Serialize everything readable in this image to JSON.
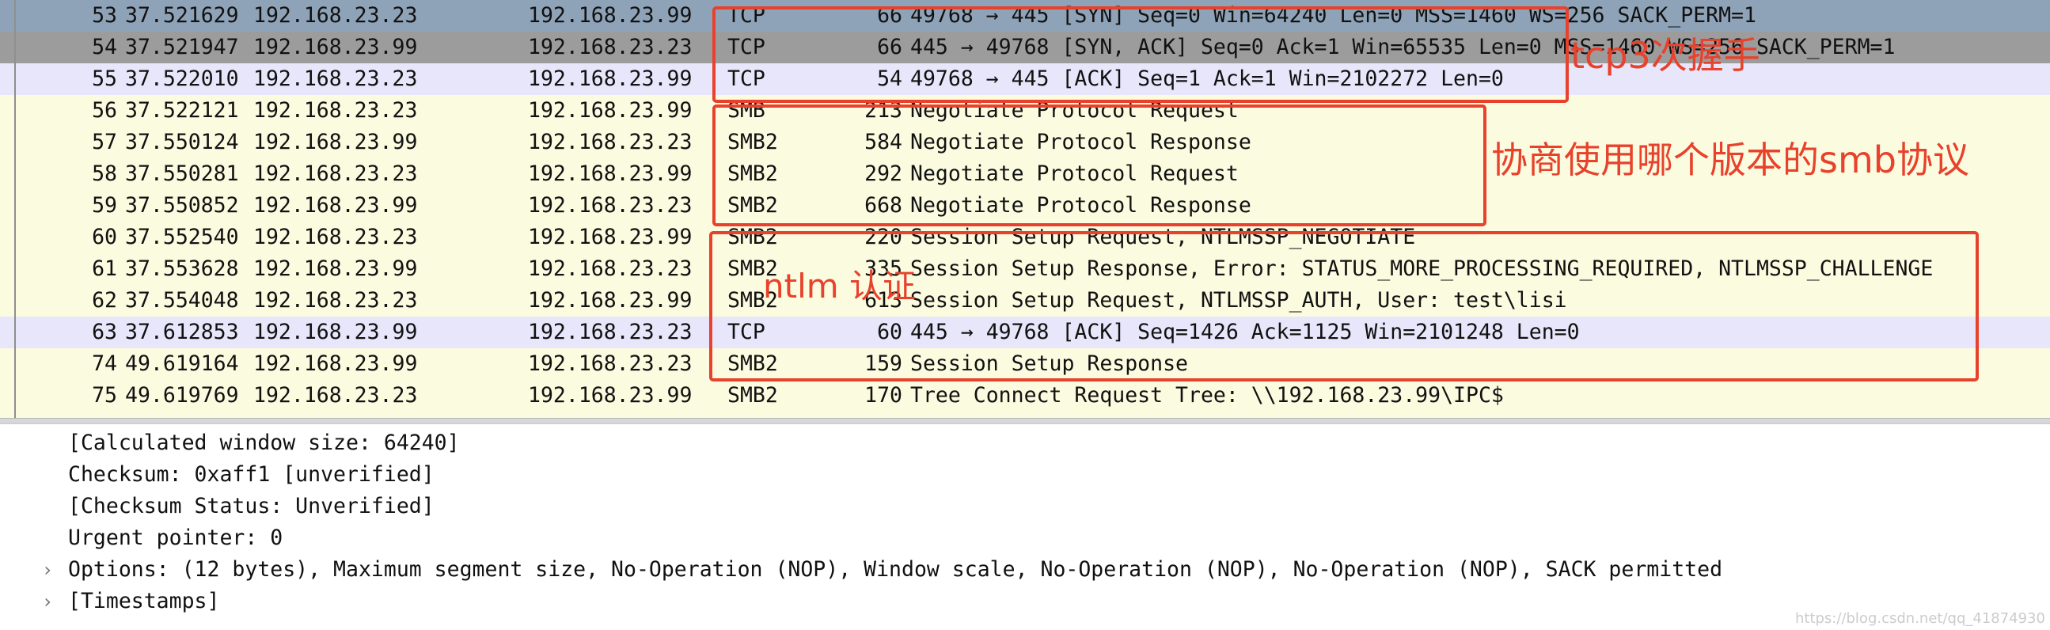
{
  "packets": [
    {
      "no": "53",
      "time": "37.521629",
      "src": "192.168.23.23",
      "dst": "192.168.23.99",
      "proto": "TCP",
      "len": "66",
      "info": "49768 → 445 [SYN] Seq=0 Win=64240 Len=0 MSS=1460 WS=256 SACK_PERM=1",
      "style": "selected"
    },
    {
      "no": "54",
      "time": "37.521947",
      "src": "192.168.23.99",
      "dst": "192.168.23.23",
      "proto": "TCP",
      "len": "66",
      "info": "445 → 49768 [SYN, ACK] Seq=0 Ack=1 Win=65535 Len=0 MSS=1460 WS=256 SACK_PERM=1",
      "style": "gray"
    },
    {
      "no": "55",
      "time": "37.522010",
      "src": "192.168.23.23",
      "dst": "192.168.23.99",
      "proto": "TCP",
      "len": "54",
      "info": "49768 → 445 [ACK] Seq=1 Ack=1 Win=2102272 Len=0",
      "style": "tcp"
    },
    {
      "no": "56",
      "time": "37.522121",
      "src": "192.168.23.23",
      "dst": "192.168.23.99",
      "proto": "SMB",
      "len": "213",
      "info": "Negotiate Protocol Request",
      "style": "smb"
    },
    {
      "no": "57",
      "time": "37.550124",
      "src": "192.168.23.99",
      "dst": "192.168.23.23",
      "proto": "SMB2",
      "len": "584",
      "info": "Negotiate Protocol Response",
      "style": "smb"
    },
    {
      "no": "58",
      "time": "37.550281",
      "src": "192.168.23.23",
      "dst": "192.168.23.99",
      "proto": "SMB2",
      "len": "292",
      "info": "Negotiate Protocol Request",
      "style": "smb"
    },
    {
      "no": "59",
      "time": "37.550852",
      "src": "192.168.23.99",
      "dst": "192.168.23.23",
      "proto": "SMB2",
      "len": "668",
      "info": "Negotiate Protocol Response",
      "style": "smb"
    },
    {
      "no": "60",
      "time": "37.552540",
      "src": "192.168.23.23",
      "dst": "192.168.23.99",
      "proto": "SMB2",
      "len": "220",
      "info": "Session Setup Request, NTLMSSP_NEGOTIATE",
      "style": "smb"
    },
    {
      "no": "61",
      "time": "37.553628",
      "src": "192.168.23.99",
      "dst": "192.168.23.23",
      "proto": "SMB2",
      "len": "335",
      "info": "Session Setup Response, Error: STATUS_MORE_PROCESSING_REQUIRED, NTLMSSP_CHALLENGE",
      "style": "smb"
    },
    {
      "no": "62",
      "time": "37.554048",
      "src": "192.168.23.23",
      "dst": "192.168.23.99",
      "proto": "SMB2",
      "len": "613",
      "info": "Session Setup Request, NTLMSSP_AUTH, User: test\\lisi",
      "style": "smb"
    },
    {
      "no": "63",
      "time": "37.612853",
      "src": "192.168.23.99",
      "dst": "192.168.23.23",
      "proto": "TCP",
      "len": "60",
      "info": "445 → 49768 [ACK] Seq=1426 Ack=1125 Win=2101248 Len=0",
      "style": "tcp"
    },
    {
      "no": "74",
      "time": "49.619164",
      "src": "192.168.23.99",
      "dst": "192.168.23.23",
      "proto": "SMB2",
      "len": "159",
      "info": "Session Setup Response",
      "style": "smb"
    },
    {
      "no": "75",
      "time": "49.619769",
      "src": "192.168.23.23",
      "dst": "192.168.23.99",
      "proto": "SMB2",
      "len": "170",
      "info": "Tree Connect Request Tree: \\\\192.168.23.99\\IPC$",
      "style": "smb"
    }
  ],
  "details": [
    {
      "text": "[Calculated window size: 64240]",
      "expander": ""
    },
    {
      "text": "Checksum: 0xaff1 [unverified]",
      "expander": ""
    },
    {
      "text": "[Checksum Status: Unverified]",
      "expander": ""
    },
    {
      "text": "Urgent pointer: 0",
      "expander": ""
    },
    {
      "text": "Options: (12 bytes), Maximum segment size, No-Operation (NOP), Window scale, No-Operation (NOP), No-Operation (NOP), SACK permitted",
      "expander": "›"
    },
    {
      "text": "[Timestamps]",
      "expander": "›"
    }
  ],
  "annotations": {
    "tcp_handshake": "tcp3次握手",
    "negotiate": "协商使用哪个版本的smb协议",
    "ntlm": "ntlm 认证"
  },
  "colors": {
    "annotation": "#e8412c",
    "selected_row": "#8fa3b8",
    "tcp_row": "#e7e6fa",
    "smb_row": "#fbfbe0"
  },
  "watermark": "https://blog.csdn.net/qq_41874930"
}
